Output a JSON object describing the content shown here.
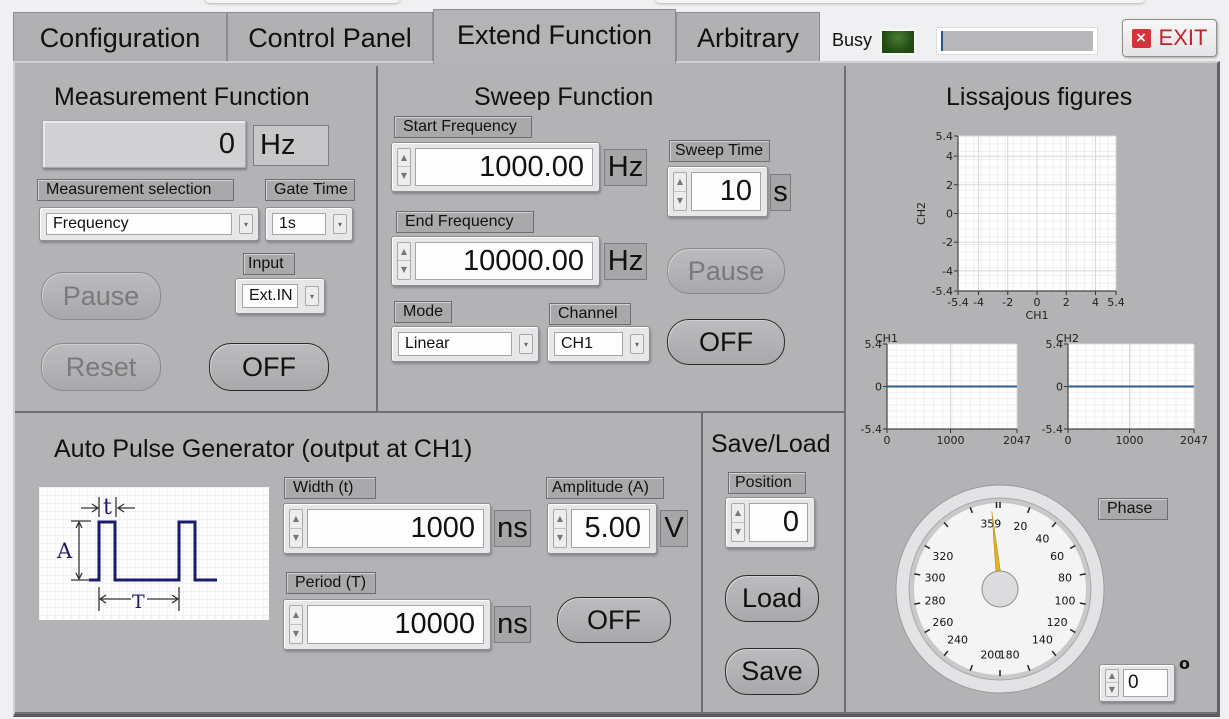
{
  "tabs": [
    {
      "label": "Configuration",
      "active": false
    },
    {
      "label": "Control Panel",
      "active": false
    },
    {
      "label": "Extend Function",
      "active": true
    },
    {
      "label": "Arbitrary",
      "active": false
    }
  ],
  "status": {
    "busy_label": "Busy",
    "busy_led_color": "#1f4a12",
    "progress": 0.0
  },
  "exit_button": {
    "label": "EXIT",
    "icon": "close-icon",
    "color": "#c8202a"
  },
  "measurement": {
    "title": "Measurement Function",
    "reading_value": "0",
    "reading_unit": "Hz",
    "selection_label": "Measurement selection",
    "selection_value": "Frequency",
    "gate_time_label": "Gate Time",
    "gate_time_value": "1s",
    "input_label": "Input",
    "input_value": "Ext.IN",
    "pause_label": "Pause",
    "reset_label": "Reset",
    "toggle_label": "OFF"
  },
  "sweep": {
    "title": "Sweep Function",
    "start_label": "Start Frequency",
    "start_value": "1000.00",
    "start_unit": "Hz",
    "end_label": "End  Frequency",
    "end_value": "10000.00",
    "end_unit": "Hz",
    "sweep_time_label": "Sweep Time",
    "sweep_time_value": "10",
    "sweep_time_unit": "s",
    "mode_label": "Mode",
    "mode_value": "Linear",
    "channel_label": "Channel",
    "channel_value": "CH1",
    "pause_label": "Pause",
    "toggle_label": "OFF"
  },
  "pulse": {
    "title": "Auto Pulse Generator (output at CH1)",
    "diagram": {
      "t_label": "t",
      "A_label": "A",
      "T_label": "T"
    },
    "width_label": "Width (t)",
    "width_value": "1000",
    "width_unit": "ns",
    "amplitude_label": "Amplitude (A)",
    "amplitude_value": "5.00",
    "amplitude_unit": "V",
    "period_label": "Period (T)",
    "period_value": "10000",
    "period_unit": "ns",
    "toggle_label": "OFF"
  },
  "saveload": {
    "title": "Save/Load",
    "position_label": "Position",
    "position_value": "0",
    "load_label": "Load",
    "save_label": "Save"
  },
  "lissajous": {
    "title": "Lissajous figures",
    "phase_label": "Phase",
    "phase_value": "0",
    "phase_unit": "°",
    "phase_degrees": 359,
    "gauge_labels": [
      "359",
      "20",
      "40",
      "60",
      "80",
      "100",
      "120",
      "140",
      "180",
      "200",
      "240",
      "260",
      "280",
      "300",
      "320"
    ]
  },
  "chart_data": [
    {
      "type": "scatter",
      "title": "",
      "xlabel": "CH1",
      "ylabel": "CH2",
      "xlim": [
        -5.4,
        5.4
      ],
      "ylim": [
        -5.4,
        5.4
      ],
      "x_ticks": [
        "-5.4",
        "-4",
        "-2",
        "0",
        "2",
        "4",
        "5.4"
      ],
      "y_ticks": [
        "5.4",
        "4",
        "2",
        "0",
        "-2",
        "-4",
        "-5.4"
      ],
      "grid": true,
      "series": []
    },
    {
      "type": "line",
      "title": "CH1",
      "xlabel": "",
      "ylabel": "",
      "xlim": [
        0,
        2047
      ],
      "ylim": [
        -5.4,
        5.4
      ],
      "x_ticks": [
        "0",
        "1000",
        "2047"
      ],
      "y_ticks": [
        "5.4",
        "0",
        "-5.4"
      ],
      "grid": true,
      "series": [
        {
          "name": "CH1",
          "x": [
            0,
            2047
          ],
          "values": [
            0,
            0
          ],
          "color": "#2f5f8a"
        }
      ]
    },
    {
      "type": "line",
      "title": "CH2",
      "xlabel": "",
      "ylabel": "",
      "xlim": [
        0,
        2047
      ],
      "ylim": [
        -5.4,
        5.4
      ],
      "x_ticks": [
        "0",
        "1000",
        "2047"
      ],
      "y_ticks": [
        "5.4",
        "0",
        "-5.4"
      ],
      "grid": true,
      "series": [
        {
          "name": "CH2",
          "x": [
            0,
            2047
          ],
          "values": [
            0,
            0
          ],
          "color": "#2f5f8a"
        }
      ]
    }
  ]
}
